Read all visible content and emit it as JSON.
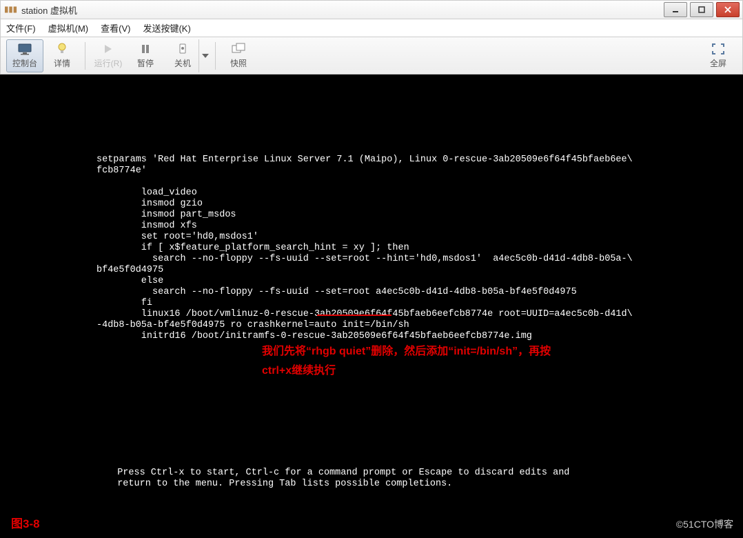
{
  "window": {
    "title": "station 虚拟机"
  },
  "menubar": {
    "file": "文件(F)",
    "vm": "虚拟机(M)",
    "view": "查看(V)",
    "sendkey": "发送按键(K)"
  },
  "toolbar": {
    "console": "控制台",
    "details": "详情",
    "run": "运行(R)",
    "pause": "暂停",
    "shutdown": "关机",
    "snapshot": "快照",
    "fullscreen": "全屏"
  },
  "terminal": {
    "body": "setparams 'Red Hat Enterprise Linux Server 7.1 (Maipo), Linux 0-rescue-3ab20509e6f64f45bfaeb6ee\\\nfcb8774e'\n\n        load_video\n        insmod gzio\n        insmod part_msdos\n        insmod xfs\n        set root='hd0,msdos1'\n        if [ x$feature_platform_search_hint = xy ]; then\n          search --no-floppy --fs-uuid --set=root --hint='hd0,msdos1'  a4ec5c0b-d41d-4db8-b05a-\\\nbf4e5f0d4975\n        else\n          search --no-floppy --fs-uuid --set=root a4ec5c0b-d41d-4db8-b05a-bf4e5f0d4975\n        fi\n        linux16 /boot/vmlinuz-0-rescue-3ab20509e6f64f45bfaeb6eefcb8774e root=UUID=a4ec5c0b-d41d\\\n-4db8-b05a-bf4e5f0d4975 ro crashkernel=auto init=/bin/sh\n        initrd16 /boot/initramfs-0-rescue-3ab20509e6f64f45bfaeb6eefcb8774e.img",
    "footer": "  Press Ctrl-x to start, Ctrl-c for a command prompt or Escape to discard edits and\n  return to the menu. Pressing Tab lists possible completions."
  },
  "annotation": {
    "line1": "我们先将“rhgb quiet”删除，然后添加“init=/bin/sh”，再按",
    "line2": "ctrl+x继续执行"
  },
  "figure_label": "图3-8",
  "watermark": "©51CTO博客"
}
